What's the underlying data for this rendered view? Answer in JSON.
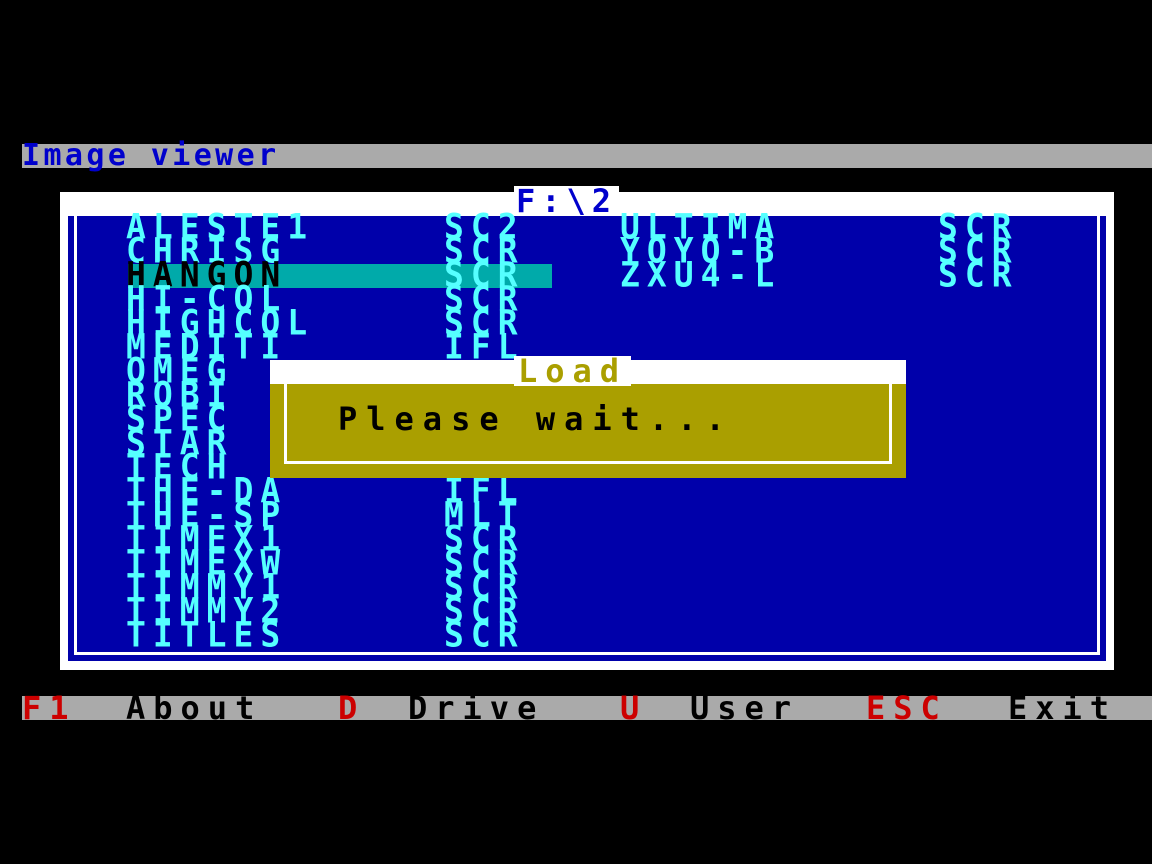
{
  "app": {
    "title": "Image viewer"
  },
  "panel": {
    "path": "F:\\2"
  },
  "files": {
    "col1": [
      {
        "name": "ALESTE1",
        "ext": "SC2"
      },
      {
        "name": "CHRISG",
        "ext": "SCR"
      },
      {
        "name": "HANGON",
        "ext": "SCR",
        "selected": true
      },
      {
        "name": "HI-COL",
        "ext": "SCR"
      },
      {
        "name": "HIGHCOL",
        "ext": "SCR"
      },
      {
        "name": "MEDITI",
        "ext": "IFL"
      },
      {
        "name": "OMEG",
        "ext": ""
      },
      {
        "name": "ROBI",
        "ext": ""
      },
      {
        "name": "SPEC",
        "ext": ""
      },
      {
        "name": "STAR",
        "ext": ""
      },
      {
        "name": "TECH",
        "ext": ""
      },
      {
        "name": "THE-DA",
        "ext": "IFL"
      },
      {
        "name": "THE-SP",
        "ext": "MLT"
      },
      {
        "name": "TIMEX1",
        "ext": "SCR"
      },
      {
        "name": "TIMEXW",
        "ext": "SCR"
      },
      {
        "name": "TIMMY1",
        "ext": "SCR"
      },
      {
        "name": "TIMMY2",
        "ext": "SCR"
      },
      {
        "name": "TITLES",
        "ext": "SCR"
      }
    ],
    "col2": [
      {
        "name": "ULTIMA",
        "ext": "SCR"
      },
      {
        "name": "YOYO-B",
        "ext": "SCR"
      },
      {
        "name": "ZXU4-L",
        "ext": "SCR"
      }
    ]
  },
  "dialog": {
    "title": "Load",
    "message": "Please wait..."
  },
  "statusbar": {
    "items": [
      {
        "key": "F1",
        "label": "About"
      },
      {
        "key": "D",
        "label": "Drive"
      },
      {
        "key": "U",
        "label": "User"
      },
      {
        "key": "ESC",
        "label": "Exit"
      }
    ]
  },
  "colors": {
    "background": "#000000",
    "bar": "#aaaaaa",
    "panel": "#0000aa",
    "file_text": "#55ffff",
    "selection": "#00aaaa",
    "dialog": "#aa9f00",
    "hotkey": "#cc0000"
  }
}
